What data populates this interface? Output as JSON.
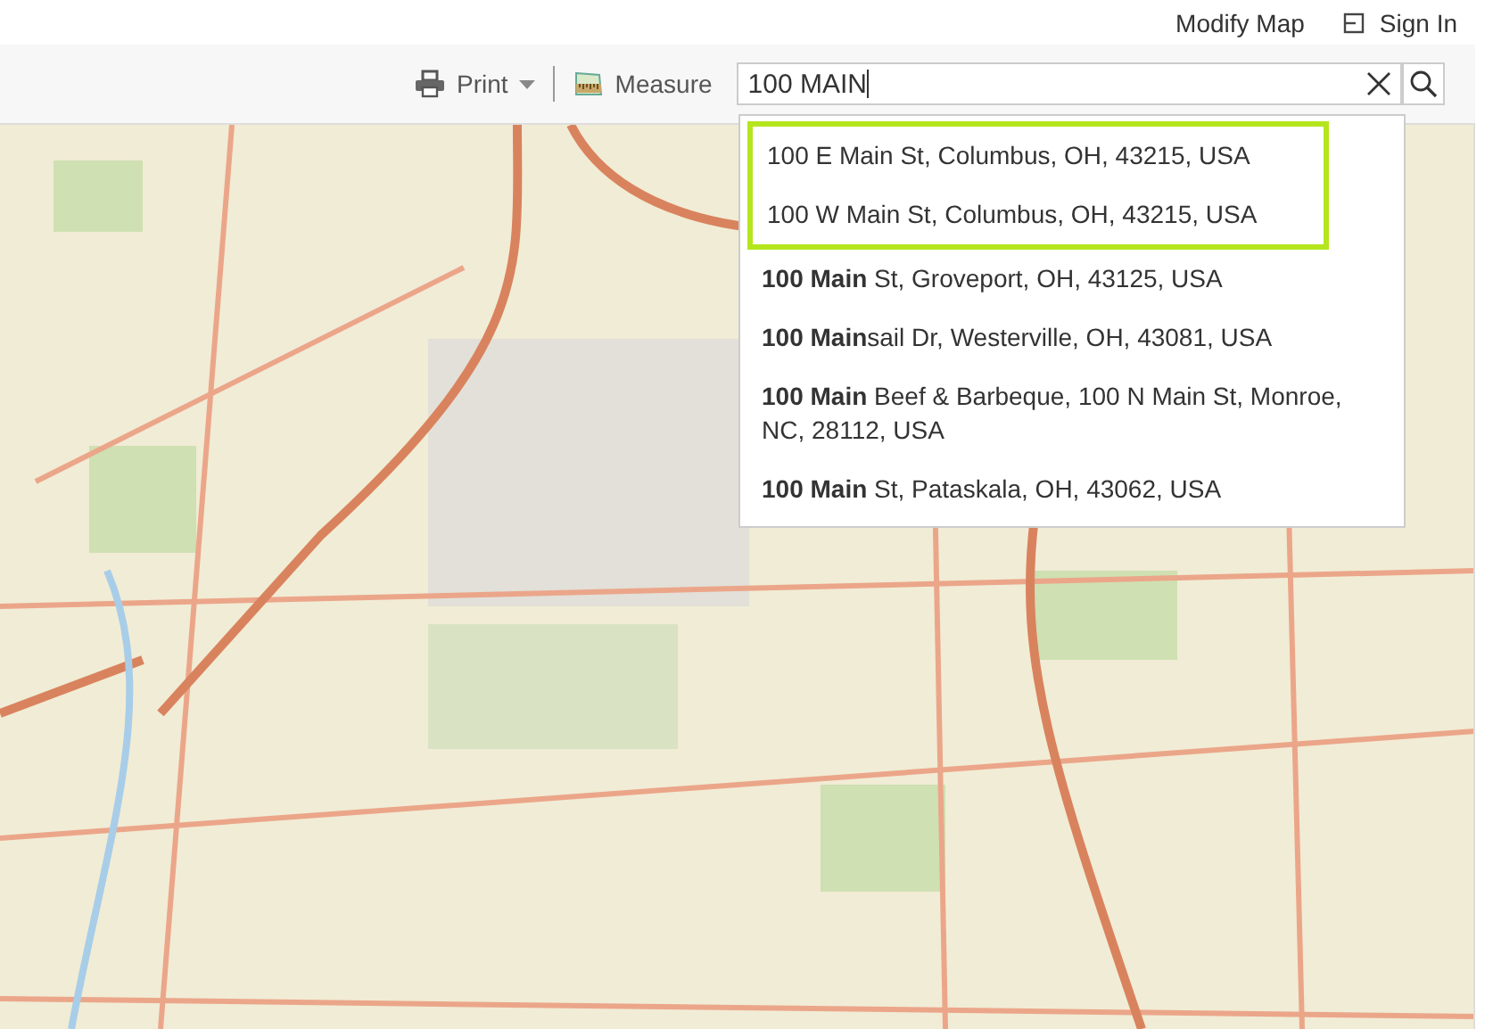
{
  "header": {
    "links": [
      "Modify Map",
      "Sign In"
    ]
  },
  "toolbar": {
    "print": "Print",
    "measure": "Measure"
  },
  "search": {
    "value": "100 MAIN"
  },
  "suggestions": [
    {
      "text": "100 E Main St, Columbus, OH, 43215, USA",
      "highlighted": true
    },
    {
      "text": "100 W Main St, Columbus, OH, 43215, USA",
      "highlighted": true
    },
    {
      "text": "**100 Main** St, Groveport, OH, 43125, USA",
      "highlighted": false
    },
    {
      "text": "**100 Main**sail Dr, Westerville, OH, 43081, USA",
      "highlighted": false
    },
    {
      "text": "**100 Main** Beef & Barbeque, 100 N Main St, Monroe, NC, 28112, USA",
      "highlighted": false
    },
    {
      "text": "**100 Main** St, Pataskala, OH, 43062, USA",
      "highlighted": false
    }
  ]
}
